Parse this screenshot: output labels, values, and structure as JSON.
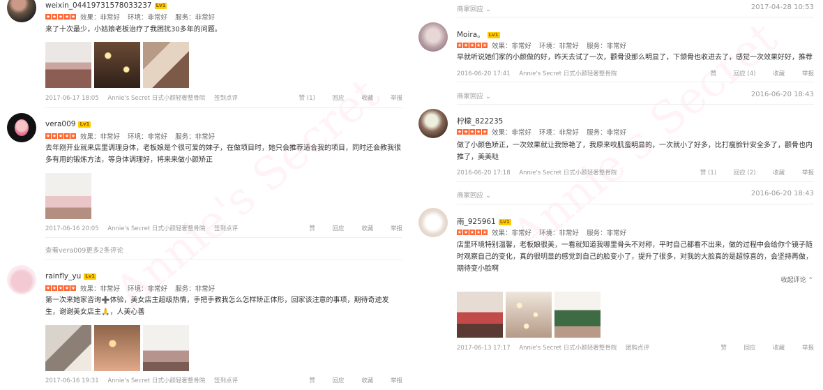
{
  "watermark": "Annie's Secret",
  "left_reviews": [
    {
      "username": "weixin_04419731578033237",
      "level": "Lv1",
      "stars": 5,
      "ratings": [
        "效果：非常好",
        "环境：非常好",
        "服务：非常好"
      ],
      "text": "来了十次最少，小姑娘老板治疗了我困扰30多年的问题。",
      "date": "2017-06-17 18:05",
      "shop": "Annie's Secret 日式小颜轻奢整骨院",
      "tag": "签到点评",
      "actions": [
        "赞 (1)",
        "回应",
        "收藏",
        "举报"
      ]
    },
    {
      "username": "vera009",
      "level": "Lv1",
      "stars": 5,
      "ratings": [
        "效果：非常好",
        "环境：非常好",
        "服务：非常好"
      ],
      "text": "去年刚开业就来店里调理身体，老板娘是个很可爱的妹子，在做项目时，她只会推荐适合我的项目，同时还会教我很多有用的锻炼方法，等身体调理好，将来来做小颜矫正",
      "date": "2017-06-16 20:05",
      "shop": "Annie's Secret 日式小颜轻奢整骨院",
      "tag": "签到点评",
      "actions": [
        "赞",
        "回应",
        "收藏",
        "举报"
      ],
      "more": "查看vera009更多2条评论"
    },
    {
      "username": "rainfly_yu",
      "level": "Lv1",
      "stars": 5,
      "ratings": [
        "效果：非常好",
        "环境：非常好",
        "服务：非常好"
      ],
      "text": "第一次来她家咨询➕体验，美女店主超级热情，手把手教我怎么怎样矫正体形，回家该注意的事项，期待奇迹发生，谢谢美女店主🙏，人美心善",
      "date": "2017-06-16 19:31",
      "shop": "Annie's Secret 日式小颜轻奢整骨院",
      "tag": "签到点评",
      "actions": [
        "赞",
        "回应",
        "收藏",
        "举报"
      ]
    }
  ],
  "right_top_merchant": {
    "label": "商家回应",
    "date": "2017-04-28 10:53"
  },
  "right_reviews": [
    {
      "username": "Moira。",
      "level": "Lv1",
      "stars": 5,
      "ratings": [
        "效果：非常好",
        "环境：非常好",
        "服务：非常好"
      ],
      "text": "早就听说她们家的小颜做的好，昨天去试了一次，颧骨没那么明显了，下颌骨也收进去了，感觉一次效果好好，推荐",
      "date": "2016-06-20 17:41",
      "shop": "Annie's Secret 日式小颜轻奢整骨院",
      "actions": [
        "赞",
        "回应 (4)",
        "收藏",
        "举报"
      ],
      "merchant": {
        "label": "商家回应",
        "date": "2016-06-20 18:43"
      }
    },
    {
      "username": "柠檬_822235",
      "level": "",
      "stars": 5,
      "ratings": [
        "效果：非常好",
        "环境：非常好",
        "服务：非常好"
      ],
      "text": "做了小颜色矫正，一次效果就让我惊艳了，我原来咬肌蛮明显的，一次就小了好多，比打瘦脸针安全多了，颧骨也内推了，美美哒",
      "date": "2016-06-20 17:18",
      "shop": "Annie's Secret 日式小颜轻奢整骨院",
      "actions": [
        "赞 (1)",
        "回应 (2)",
        "收藏",
        "举报"
      ],
      "merchant": {
        "label": "商家回应",
        "date": "2016-06-20 18:43"
      }
    },
    {
      "username": "雨_925961",
      "level": "Lv1",
      "stars": 5,
      "ratings": [
        "效果：非常好",
        "环境：非常好",
        "服务：非常好"
      ],
      "text": "店里环境特别温馨，老板娘很美，一看就知道我哪里骨头不对称，平时自己都看不出来，做的过程中会给你个镜子随时观察自己的变化，真的很明显的感觉到自己的脸变小了，提升了很多，对我的大脸真的是超惊喜的，会坚持再做，期待变小脸啊",
      "collapse": "收起评论",
      "date": "2017-06-13 17:17",
      "shop": "Annie's Secret 日式小颜轻奢整骨院",
      "tag": "团购点评",
      "actions": [
        "赞",
        "回应",
        "收藏",
        "举报"
      ]
    }
  ]
}
